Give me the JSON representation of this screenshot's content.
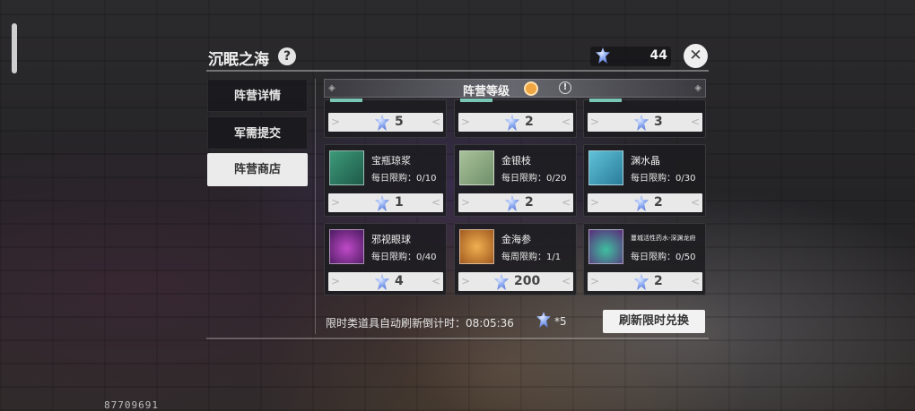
{
  "panel": {
    "title": "沉眠之海",
    "help": "?"
  },
  "currency": {
    "amount": "44",
    "icon": "crystal-gem-icon",
    "color": "#8aa8f0"
  },
  "close": {
    "glyph": "✕"
  },
  "tabs": [
    {
      "label": "阵营详情",
      "active": false
    },
    {
      "label": "军需提交",
      "active": false
    },
    {
      "label": "阵营商店",
      "active": true
    }
  ],
  "faction_bar": {
    "label": "阵营等级",
    "info": "!"
  },
  "top_row_prices": [
    "5",
    "2",
    "3"
  ],
  "items": [
    {
      "name": "宝瓶琼浆",
      "limit": "每日限购：0/10",
      "price": "1",
      "icon": "jade-vase-icon"
    },
    {
      "name": "金银枝",
      "limit": "每日限购：0/20",
      "price": "2",
      "icon": "gold-silver-branch-icon"
    },
    {
      "name": "渊水晶",
      "limit": "每日限购：0/30",
      "price": "2",
      "icon": "abyss-crystal-icon"
    },
    {
      "name": "邪视眼球",
      "limit": "每日限购：0/40",
      "price": "4",
      "icon": "evil-eye-icon"
    },
    {
      "name": "金海参",
      "limit": "每周限购：1/1",
      "price": "200",
      "icon": "golden-sea-cucumber-icon"
    },
    {
      "name": "蔓城活性药水-深渊龙府",
      "limit": "每日限购：0/50",
      "price": "2",
      "icon": "potion-bottle-icon"
    }
  ],
  "footer": {
    "timer_label": "限时类道具自动刷新倒计时：",
    "timer_value": "08:05:36",
    "cost": "*5",
    "refresh_label": "刷新限时兑换"
  },
  "uid": "87709691"
}
